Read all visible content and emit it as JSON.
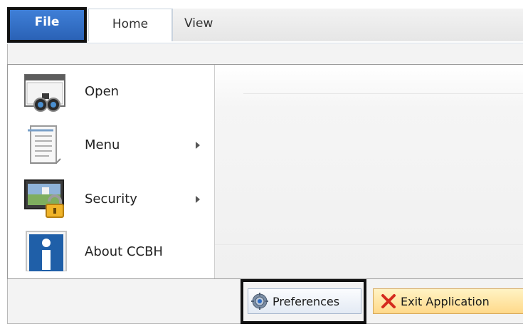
{
  "tabs": {
    "file": "File",
    "home": "Home",
    "view": "View"
  },
  "menu": {
    "items": [
      {
        "label": "Open",
        "icon": "binoculars-window-icon",
        "has_submenu": false
      },
      {
        "label": "Menu",
        "icon": "document-list-icon",
        "has_submenu": true
      },
      {
        "label": "Security",
        "icon": "padlock-window-icon",
        "has_submenu": true
      },
      {
        "label": "About CCBH",
        "icon": "info-icon",
        "has_submenu": false
      }
    ]
  },
  "footer": {
    "preferences_label": "Preferences",
    "preferences_icon": "gear-icon",
    "exit_label": "Exit Application",
    "exit_icon": "red-x-icon"
  },
  "colors": {
    "file_tab": "#2f6cc4",
    "exit_button": "#ffd98a",
    "highlight_border": "#111111"
  }
}
